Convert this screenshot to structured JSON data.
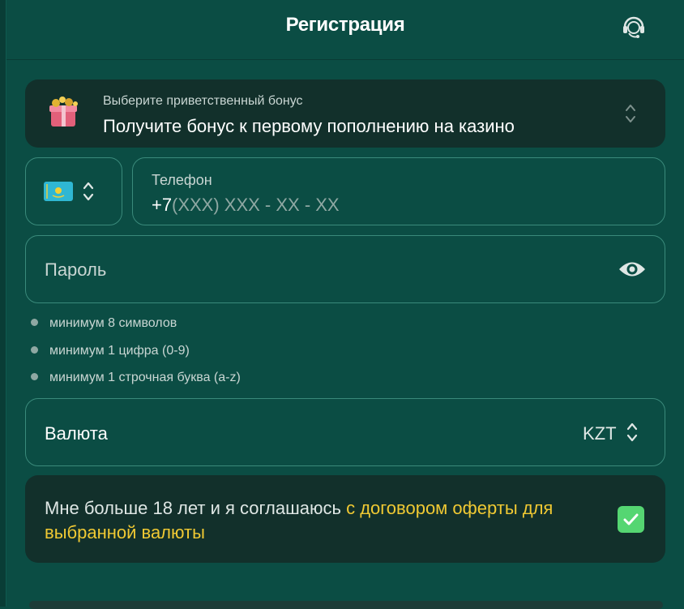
{
  "header": {
    "title": "Регистрация",
    "support_icon": "headset-icon"
  },
  "bonus": {
    "hint": "Выберите приветственный бонус",
    "value": "Получите бонус к первому пополнению на казино",
    "icon": "gift-box-icon"
  },
  "phone": {
    "country_flag": "kazakhstan-flag-icon",
    "label": "Телефон",
    "code": "+7",
    "placeholder": "(XXX) XXX - XX - XX"
  },
  "password": {
    "placeholder": "Пароль",
    "rules": [
      "минимум 8 символов",
      "минимум 1 цифра (0-9)",
      "минимум 1 строчная буква (a-z)"
    ]
  },
  "currency": {
    "label": "Валюта",
    "value": "KZT"
  },
  "agreement": {
    "text": "Мне больше 18 лет и я соглашаюсь ",
    "link": "с договором оферты для выбранной валюты",
    "checked": true
  },
  "colors": {
    "background": "#0b4d44",
    "card": "#12302b",
    "accent": "#f0c933",
    "check": "#55d672"
  }
}
